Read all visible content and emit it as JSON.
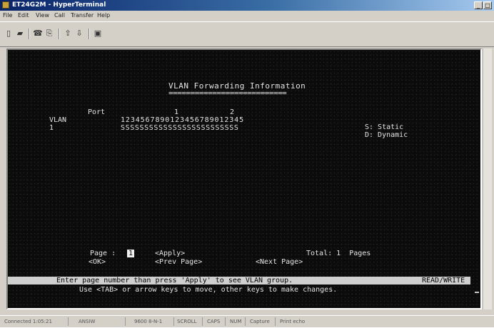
{
  "window": {
    "title": "ET24G2M - HyperTerminal",
    "min": "_",
    "max": "□"
  },
  "menu": [
    "File",
    "Edit",
    "View",
    "Call",
    "Transfer",
    "Help"
  ],
  "toolbar": [
    "new-icon",
    "open-icon",
    "disconnect-icon",
    "properties-icon",
    "send-icon",
    "receive-icon",
    "props2-icon"
  ],
  "terminal": {
    "title": "VLAN Forwarding Information",
    "title_underline": "===========================",
    "port_label": "Port",
    "port_tens_1": "1",
    "port_tens_2": "2",
    "vlan_label": "VLAN",
    "port_numbers": "1234567890123456789012345",
    "vlan_id": "1",
    "vlan_row": "SSSSSSSSSSSSSSSSSSSSSSSSS",
    "legend_static": "S: Static",
    "legend_dynamic": "D: Dynamic",
    "page_label": "Page :",
    "page_value": "1",
    "apply": "<Apply>",
    "total": "Total: 1  Pages",
    "ok": "<OK>",
    "prev_page": "<Prev Page>",
    "next_page": "<Next Page>",
    "help_line": "Enter page number than press 'Apply' to see VLAN group.",
    "mode": "READ/WRITE",
    "nav_hint": "Use <TAB> or arrow keys to move, other keys to make changes."
  },
  "statusbar": {
    "connected": "Connected 1:05:21",
    "emulation": "ANSIW",
    "settings": "9600 8-N-1",
    "scroll": "SCROLL",
    "caps": "CAPS",
    "num": "NUM",
    "capture": "Capture",
    "print_echo": "Print echo"
  }
}
